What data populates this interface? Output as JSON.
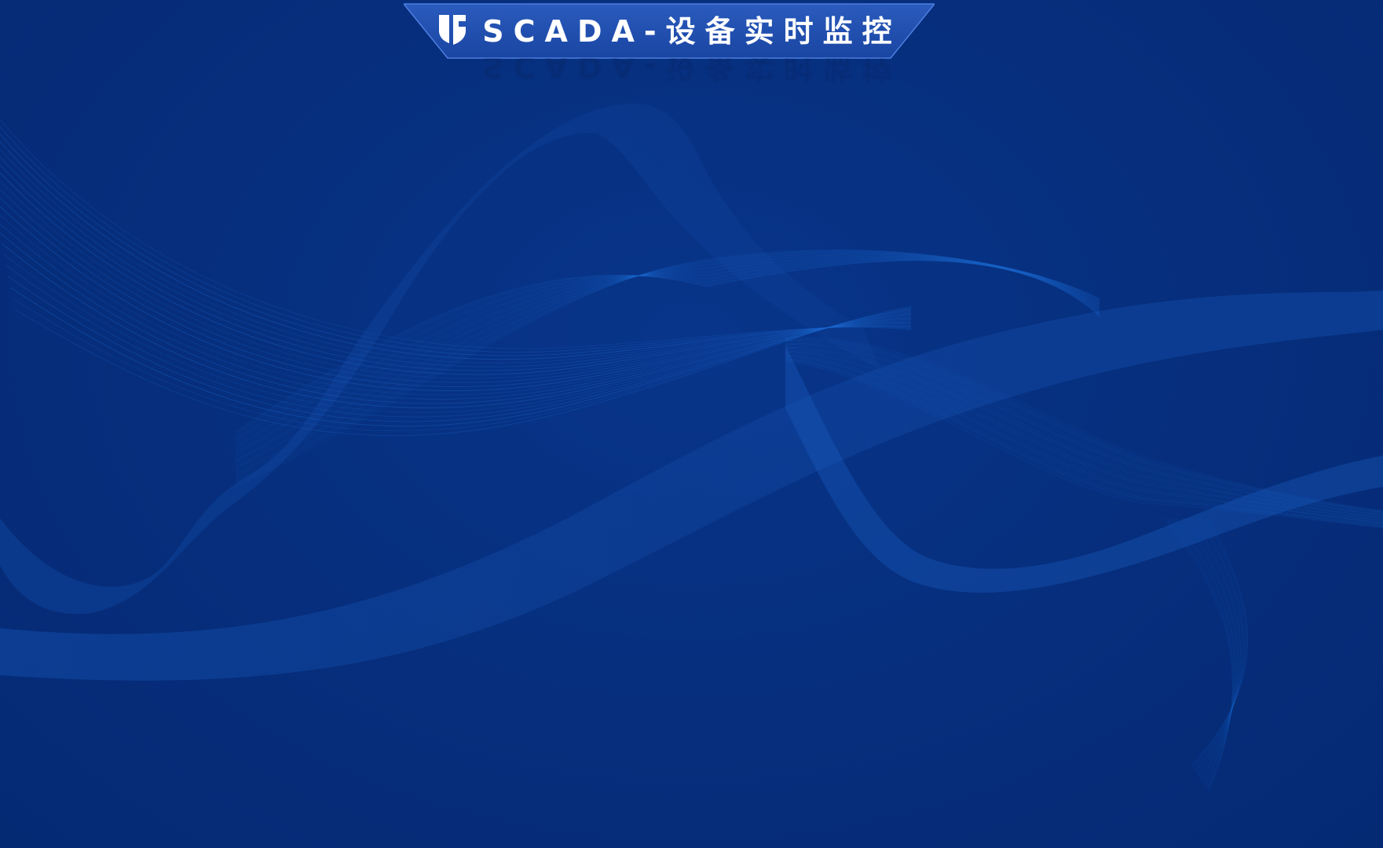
{
  "header": {
    "title": "SCADA-设备实时监控",
    "logo_icon": "shield-icon"
  },
  "colors": {
    "background": "#062e7c",
    "banner": "#1f4ba8",
    "banner_border": "#3f6fd6",
    "wave": "#1c64c8",
    "title_text": "#ffffff"
  }
}
